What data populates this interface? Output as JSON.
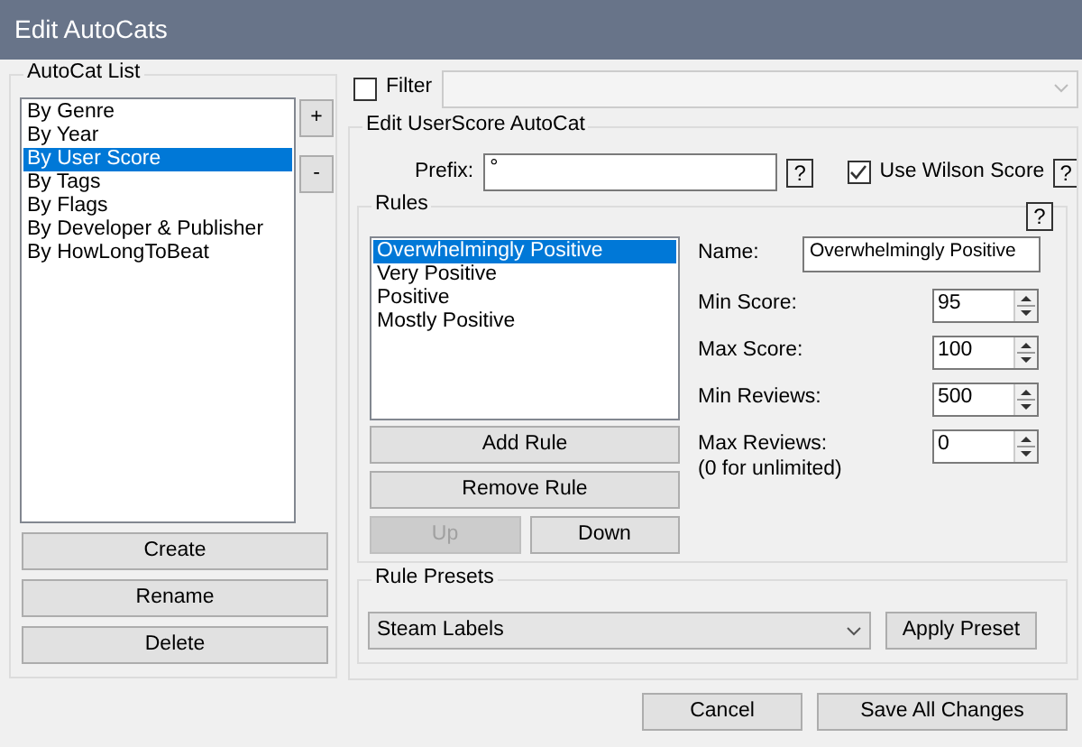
{
  "window": {
    "title": "Edit AutoCats"
  },
  "autocat_list": {
    "title": "AutoCat List",
    "items": [
      {
        "label": "By Genre",
        "selected": false
      },
      {
        "label": "By Year",
        "selected": false
      },
      {
        "label": "By User Score",
        "selected": true
      },
      {
        "label": "By Tags",
        "selected": false
      },
      {
        "label": "By Flags",
        "selected": false
      },
      {
        "label": "By Developer & Publisher",
        "selected": false
      },
      {
        "label": "By HowLongToBeat",
        "selected": false
      }
    ],
    "add_button": "+",
    "remove_button": "-",
    "buttons": [
      "Create",
      "Rename",
      "Delete"
    ]
  },
  "filter": {
    "label": "Filter",
    "checked": false
  },
  "editor": {
    "title": "Edit UserScore AutoCat",
    "prefix_label": "Prefix:",
    "prefix_value": "°",
    "prefix_help": "?",
    "wilson": {
      "label": "Use Wilson Score",
      "checked": true
    },
    "wilson_help": "?",
    "rules": {
      "title": "Rules",
      "help": "?",
      "items": [
        {
          "label": "Overwhelmingly Positive",
          "selected": true
        },
        {
          "label": "Very Positive",
          "selected": false
        },
        {
          "label": "Positive",
          "selected": false
        },
        {
          "label": "Mostly Positive",
          "selected": false
        }
      ],
      "button_rows": [
        [
          {
            "label": "Add Rule",
            "disabled": false
          }
        ],
        [
          {
            "label": "Remove Rule",
            "disabled": false
          }
        ],
        [
          {
            "label": "Up",
            "disabled": true
          },
          {
            "label": "Down",
            "disabled": false
          }
        ]
      ],
      "name_label": "Name:",
      "name_value": "Overwhelmingly Positive",
      "fields": [
        {
          "label": "Min Score:",
          "value": "95"
        },
        {
          "label": "Max Score:",
          "value": "100"
        },
        {
          "label": "Min Reviews:",
          "value": "500"
        },
        {
          "label": "Max Reviews:",
          "note": "(0 for unlimited)",
          "value": "0"
        }
      ]
    },
    "presets": {
      "title": "Rule Presets",
      "value": "Steam Labels",
      "button": "Apply Preset"
    }
  },
  "buttons": [
    "Cancel",
    "Save All Changes"
  ]
}
